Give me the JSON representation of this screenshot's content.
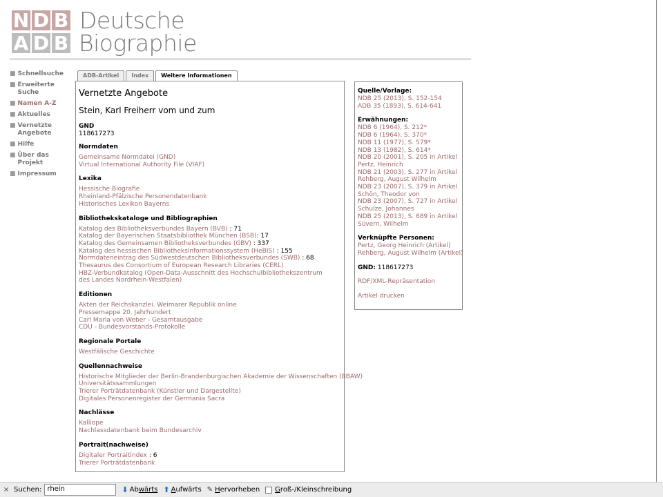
{
  "logo": {
    "row1_letters": [
      "N",
      "D",
      "B"
    ],
    "row1_word": "Deutsche",
    "row2_letters": [
      "A",
      "D",
      "B"
    ],
    "row2_word": "Biographie"
  },
  "nav": {
    "items": [
      {
        "label": "Schnellsuche"
      },
      {
        "label": "Erweiterte Suche"
      },
      {
        "label": "Namen A-Z"
      },
      {
        "label": "Aktuelles"
      },
      {
        "label": "Vernetzte Angebote"
      },
      {
        "label": "Hilfe"
      },
      {
        "label": "Über das Projekt"
      },
      {
        "label": "Impressum"
      }
    ]
  },
  "tabs": [
    {
      "label": "ADB-Artikel"
    },
    {
      "label": "Index"
    },
    {
      "label": "Weitere Informationen"
    }
  ],
  "main": {
    "heading": "Vernetzte Angebote",
    "person": "Stein, Karl Freiherr vom und zum",
    "gnd_label": "GND",
    "gnd_value": "118617273",
    "normdaten": {
      "title": "Normdaten",
      "links": [
        "Gemeinsame Normdatei (GND)",
        "Virtual International Authority File (VIAF)"
      ]
    },
    "lexika": {
      "title": "Lexika",
      "links": [
        "Hessische Biografie",
        "Rheinland-Pfälzische Personendatenbank",
        "Historisches Lexikon Bayerns"
      ]
    },
    "bibliothek": {
      "title": "Bibliothekskataloge und Bibliographien",
      "items": [
        {
          "link": "Katalog des Bibliotheksverbundes Bayern (BVB)",
          "count": " : 71"
        },
        {
          "link": "Katalog der Bayerischen Staatsbibliothek München (BSB)",
          "count": ": 17"
        },
        {
          "link": "Katalog des Gemeinsamen Bibliotheksverbundes (GBV)",
          "count": " : 337"
        },
        {
          "link": "Katalog des hessischen Bibliotheksinformationssystem (HeBIS)",
          "count": " : 155"
        },
        {
          "link": "Normdateneintrag des Südwestdeutschen Bibliotheksverbundes (SWB)",
          "count": " : 68"
        },
        {
          "link": "Thesaurus des Consortium of European Research Libraries (CERL)",
          "count": ""
        },
        {
          "link": "HBZ-Verbundkatalog (Open-Data-Ausschnitt des Hochschulbibliothekszentrum des Landes Nordrhein-Westfalen)",
          "count": ""
        }
      ]
    },
    "editionen": {
      "title": "Editionen",
      "links": [
        "Akten der Reichskanzlei. Weimarer Republik online",
        "Pressemappe 20. Jahrhundert",
        "Carl Maria von Weber - Gesamtausgabe",
        "CDU - Bundesvorstands-Protokolle"
      ]
    },
    "regionale": {
      "title": "Regionale Portale",
      "links": [
        "Westfälische Geschichte"
      ]
    },
    "quellen": {
      "title": "Quellennachweise",
      "links": [
        "Historische Mitglieder der Berlin-Brandenburgischen Akademie der Wissenschaften (BBAW)",
        "Universitätssammlungen",
        "Trierer Porträtdatenbank (Künstler und Dargestellte)",
        "Digitales Personenregister der Germania Sacra"
      ]
    },
    "nachlaesse": {
      "title": "Nachlässe",
      "links": [
        "Kalliope",
        "Nachlassdatenbank beim Bundesarchiv"
      ]
    },
    "portrait": {
      "title": "Portrait(nachweise)",
      "items": [
        {
          "link": "Digitaler Portraitindex",
          "count": " : 6"
        },
        {
          "link": "Trierer Porträtdatenbank",
          "count": ""
        }
      ]
    }
  },
  "side": {
    "quelle_title": "Quelle/Vorlage:",
    "quelle_links": [
      "NDB 25 (2013), S. 152-154",
      "ADB 35 (1893), S. 614-641"
    ],
    "erw_title": "Erwähnungen:",
    "erw_links": [
      "NDB 6 (1964), S. 212*",
      "NDB 6 (1964), S. 370*",
      "NDB 11 (1977), S. 579*",
      "NDB 13 (1982), S. 614*",
      "NDB 20 (2001), S. 205 in Artikel Pertz, Heinrich",
      "NDB 21 (2003), S. 277 in Artikel Rehberg, August Wilhelm",
      "NDB 23 (2007), S. 379 in Artikel Schön, Theodor von",
      "NDB 23 (2007), S. 727 in Artikel Schulze, Johannes",
      "NDB 25 (2013), S. 689 in Artikel Süvern, Wilhelm"
    ],
    "verk_title": "Verknüpfte Personen:",
    "verk_links": [
      "Pertz, Georg Heinrich (Artikel)",
      "Rehberg, August Wilhelm (Artikel)"
    ],
    "gnd_label": "GND:",
    "gnd_value": " 118617273",
    "rdf": "RDF/XML-Repräsentation",
    "print": "Artikel drucken"
  },
  "findbar": {
    "close": "×",
    "label": "Suchen:",
    "value": "rhein",
    "down_prefix": "Ab",
    "down_rest": "wärts",
    "up_prefix": "A",
    "up_rest": "ufwärts",
    "highlight_prefix": "H",
    "highlight_rest": "ervorheben",
    "case_prefix": "G",
    "case_rest": "roß-/Kleinschreibung"
  },
  "colors": {
    "link": "#9c6b6b",
    "logo_top": "#c7a6a4",
    "logo_bottom": "#bdbdbd",
    "findbar_icon": "#2a6ab8"
  }
}
